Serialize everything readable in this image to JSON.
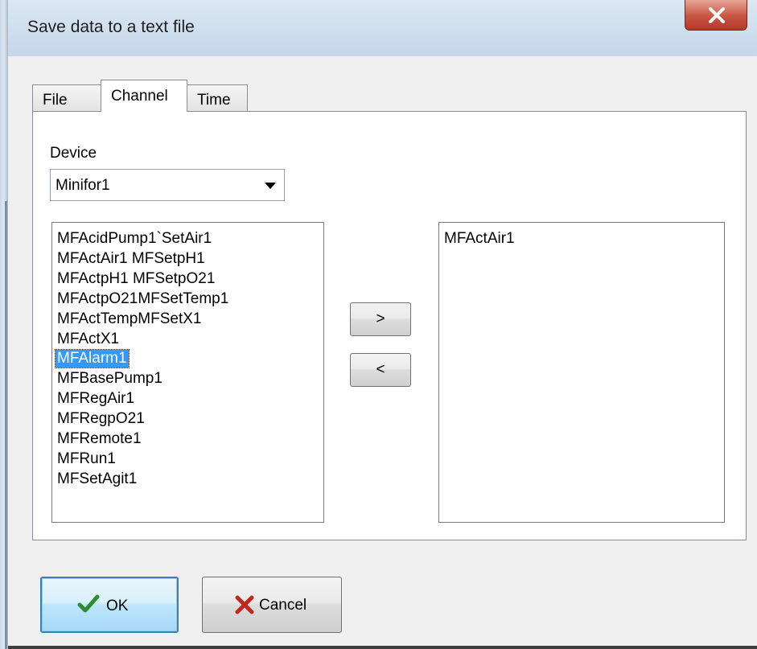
{
  "window": {
    "title": "Save data to a text file"
  },
  "tabs": [
    {
      "label": "File"
    },
    {
      "label": "Channel"
    },
    {
      "label": "Time"
    }
  ],
  "device": {
    "label": "Device",
    "selected": "Minifor1"
  },
  "available_channels": [
    "MFAcidPump1`SetAir1",
    "MFActAir1  MFSetpH1",
    "MFActpH1  MFSetpO21",
    "MFActpO21MFSetTemp1",
    "MFActTempMFSetX1",
    "MFActX1",
    "MFAlarm1",
    "MFBasePump1",
    "MFRegAir1",
    "MFRegpO21",
    "MFRemote1",
    "MFRun1",
    "MFSetAgit1"
  ],
  "selected_available_index": 6,
  "chosen_channels": [
    "MFActAir1"
  ],
  "buttons": {
    "add": ">",
    "remove": "<",
    "ok": "OK",
    "cancel": "Cancel"
  },
  "colors": {
    "selection": "#3399ff",
    "ok_check": "#2e8b2e",
    "cancel_x": "#c0281e"
  }
}
